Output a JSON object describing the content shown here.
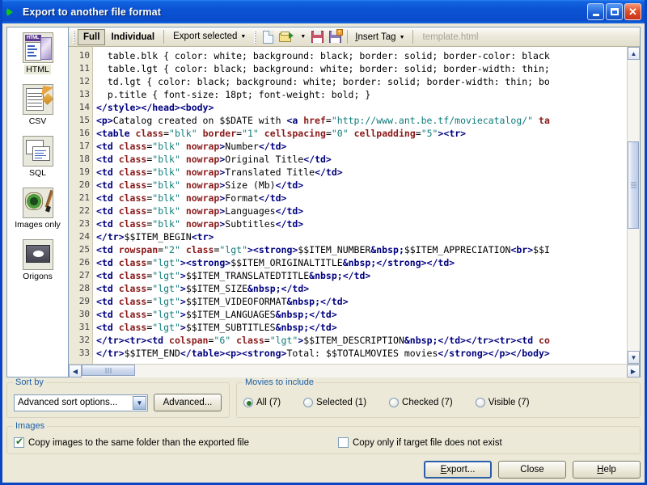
{
  "window": {
    "title": "Export to another file format",
    "icon": "green-arrow-icon",
    "controls": {
      "minimize": "minimize-button",
      "maximize": "maximize-button",
      "close": "close-button"
    }
  },
  "sidebar": {
    "items": [
      {
        "label": "HTML",
        "icon": "html-icon",
        "selected": true
      },
      {
        "label": "CSV",
        "icon": "csv-icon",
        "selected": false
      },
      {
        "label": "SQL",
        "icon": "sql-icon",
        "selected": false
      },
      {
        "label": "Images only",
        "icon": "images-only-icon",
        "selected": false
      },
      {
        "label": "Origons",
        "icon": "origons-icon",
        "selected": false
      }
    ]
  },
  "toolbar": {
    "full_label": "Full",
    "individual_label": "Individual",
    "export_selected_label": "Export selected",
    "new_icon": "new-document-icon",
    "open_icon": "open-folder-icon",
    "save_icon": "save-icon",
    "save_as_icon": "save-as-icon",
    "insert_tag_label_pre": "I",
    "insert_tag_label_post": "nsert Tag",
    "filename": "template.html"
  },
  "editor": {
    "first_line_number": 10,
    "lines": [
      {
        "n": 10,
        "segments": [
          {
            "t": "  table.blk { color: white; background: black; border: solid; border-color: black",
            "c": "t-txt"
          }
        ]
      },
      {
        "n": 11,
        "segments": [
          {
            "t": "  table.lgt { color: black; background: white; border: solid; border-width: thin;",
            "c": "t-txt"
          }
        ]
      },
      {
        "n": 12,
        "segments": [
          {
            "t": "  td.lgt { color: black; background: white; border: solid; border-width: thin; bo",
            "c": "t-txt"
          }
        ]
      },
      {
        "n": 13,
        "segments": [
          {
            "t": "  p.title { font-size: 18pt; font-weight: bold; }",
            "c": "t-txt"
          }
        ]
      },
      {
        "n": 14,
        "segments": [
          {
            "t": "</style><",
            "c": "t-tag"
          },
          {
            "t": "/head><body>",
            "c": "t-tag"
          }
        ]
      },
      {
        "n": 15,
        "segments": [
          {
            "t": "<p>",
            "c": "t-tag"
          },
          {
            "t": "Catalog created on $$DATE with ",
            "c": "t-txt"
          },
          {
            "t": "<a ",
            "c": "t-tag"
          },
          {
            "t": "href",
            "c": "t-attr"
          },
          {
            "t": "=",
            "c": "t-txt"
          },
          {
            "t": "\"http://www.ant.be.tf/moviecatalog/\"",
            "c": "t-val"
          },
          {
            "t": " ta",
            "c": "t-attr"
          }
        ]
      },
      {
        "n": 16,
        "segments": [
          {
            "t": "<table ",
            "c": "t-tag"
          },
          {
            "t": "class",
            "c": "t-attr"
          },
          {
            "t": "=",
            "c": "t-txt"
          },
          {
            "t": "\"blk\"",
            "c": "t-val"
          },
          {
            "t": " border",
            "c": "t-attr"
          },
          {
            "t": "=",
            "c": "t-txt"
          },
          {
            "t": "\"1\"",
            "c": "t-val"
          },
          {
            "t": " cellspacing",
            "c": "t-attr"
          },
          {
            "t": "=",
            "c": "t-txt"
          },
          {
            "t": "\"0\"",
            "c": "t-val"
          },
          {
            "t": " cellpadding",
            "c": "t-attr"
          },
          {
            "t": "=",
            "c": "t-txt"
          },
          {
            "t": "\"5\"",
            "c": "t-val"
          },
          {
            "t": "><tr>",
            "c": "t-tag"
          }
        ]
      },
      {
        "n": 17,
        "segments": [
          {
            "t": "<td ",
            "c": "t-tag"
          },
          {
            "t": "class",
            "c": "t-attr"
          },
          {
            "t": "=",
            "c": "t-txt"
          },
          {
            "t": "\"blk\"",
            "c": "t-val"
          },
          {
            "t": " nowrap",
            "c": "t-attr"
          },
          {
            "t": ">",
            "c": "t-tag"
          },
          {
            "t": "Number",
            "c": "t-txt"
          },
          {
            "t": "</td>",
            "c": "t-tag"
          }
        ]
      },
      {
        "n": 18,
        "segments": [
          {
            "t": "<td ",
            "c": "t-tag"
          },
          {
            "t": "class",
            "c": "t-attr"
          },
          {
            "t": "=",
            "c": "t-txt"
          },
          {
            "t": "\"blk\"",
            "c": "t-val"
          },
          {
            "t": " nowrap",
            "c": "t-attr"
          },
          {
            "t": ">",
            "c": "t-tag"
          },
          {
            "t": "Original Title",
            "c": "t-txt"
          },
          {
            "t": "</td>",
            "c": "t-tag"
          }
        ]
      },
      {
        "n": 19,
        "segments": [
          {
            "t": "<td ",
            "c": "t-tag"
          },
          {
            "t": "class",
            "c": "t-attr"
          },
          {
            "t": "=",
            "c": "t-txt"
          },
          {
            "t": "\"blk\"",
            "c": "t-val"
          },
          {
            "t": " nowrap",
            "c": "t-attr"
          },
          {
            "t": ">",
            "c": "t-tag"
          },
          {
            "t": "Translated Title",
            "c": "t-txt"
          },
          {
            "t": "</td>",
            "c": "t-tag"
          }
        ]
      },
      {
        "n": 20,
        "segments": [
          {
            "t": "<td ",
            "c": "t-tag"
          },
          {
            "t": "class",
            "c": "t-attr"
          },
          {
            "t": "=",
            "c": "t-txt"
          },
          {
            "t": "\"blk\"",
            "c": "t-val"
          },
          {
            "t": " nowrap",
            "c": "t-attr"
          },
          {
            "t": ">",
            "c": "t-tag"
          },
          {
            "t": "Size (Mb)",
            "c": "t-txt"
          },
          {
            "t": "</td>",
            "c": "t-tag"
          }
        ]
      },
      {
        "n": 21,
        "segments": [
          {
            "t": "<td ",
            "c": "t-tag"
          },
          {
            "t": "class",
            "c": "t-attr"
          },
          {
            "t": "=",
            "c": "t-txt"
          },
          {
            "t": "\"blk\"",
            "c": "t-val"
          },
          {
            "t": " nowrap",
            "c": "t-attr"
          },
          {
            "t": ">",
            "c": "t-tag"
          },
          {
            "t": "Format",
            "c": "t-txt"
          },
          {
            "t": "</td>",
            "c": "t-tag"
          }
        ]
      },
      {
        "n": 22,
        "segments": [
          {
            "t": "<td ",
            "c": "t-tag"
          },
          {
            "t": "class",
            "c": "t-attr"
          },
          {
            "t": "=",
            "c": "t-txt"
          },
          {
            "t": "\"blk\"",
            "c": "t-val"
          },
          {
            "t": " nowrap",
            "c": "t-attr"
          },
          {
            "t": ">",
            "c": "t-tag"
          },
          {
            "t": "Languages",
            "c": "t-txt"
          },
          {
            "t": "</td>",
            "c": "t-tag"
          }
        ]
      },
      {
        "n": 23,
        "segments": [
          {
            "t": "<td ",
            "c": "t-tag"
          },
          {
            "t": "class",
            "c": "t-attr"
          },
          {
            "t": "=",
            "c": "t-txt"
          },
          {
            "t": "\"blk\"",
            "c": "t-val"
          },
          {
            "t": " nowrap",
            "c": "t-attr"
          },
          {
            "t": ">",
            "c": "t-tag"
          },
          {
            "t": "Subtitles",
            "c": "t-txt"
          },
          {
            "t": "</td>",
            "c": "t-tag"
          }
        ]
      },
      {
        "n": 24,
        "segments": [
          {
            "t": "</tr>",
            "c": "t-tag"
          },
          {
            "t": "$$ITEM_BEGIN",
            "c": "t-txt"
          },
          {
            "t": "<tr>",
            "c": "t-tag"
          }
        ]
      },
      {
        "n": 25,
        "segments": [
          {
            "t": "<td ",
            "c": "t-tag"
          },
          {
            "t": "rowspan",
            "c": "t-attr"
          },
          {
            "t": "=",
            "c": "t-txt"
          },
          {
            "t": "\"2\"",
            "c": "t-val"
          },
          {
            "t": " class",
            "c": "t-attr"
          },
          {
            "t": "=",
            "c": "t-txt"
          },
          {
            "t": "\"lgt\"",
            "c": "t-val"
          },
          {
            "t": "><strong>",
            "c": "t-tag"
          },
          {
            "t": "$$ITEM_NUMBER",
            "c": "t-txt"
          },
          {
            "t": "&nbsp;",
            "c": "t-ent"
          },
          {
            "t": "$$ITEM_APPRECIATION",
            "c": "t-txt"
          },
          {
            "t": "<br>",
            "c": "t-tag"
          },
          {
            "t": "$$I",
            "c": "t-txt"
          }
        ]
      },
      {
        "n": 26,
        "segments": [
          {
            "t": "<td ",
            "c": "t-tag"
          },
          {
            "t": "class",
            "c": "t-attr"
          },
          {
            "t": "=",
            "c": "t-txt"
          },
          {
            "t": "\"lgt\"",
            "c": "t-val"
          },
          {
            "t": "><strong>",
            "c": "t-tag"
          },
          {
            "t": "$$ITEM_ORIGINALTITLE",
            "c": "t-txt"
          },
          {
            "t": "&nbsp;",
            "c": "t-ent"
          },
          {
            "t": "</strong>",
            "c": "t-tag"
          },
          {
            "t": "</td>",
            "c": "t-tag"
          }
        ]
      },
      {
        "n": 27,
        "segments": [
          {
            "t": "<td ",
            "c": "t-tag"
          },
          {
            "t": "class",
            "c": "t-attr"
          },
          {
            "t": "=",
            "c": "t-txt"
          },
          {
            "t": "\"lgt\"",
            "c": "t-val"
          },
          {
            "t": ">",
            "c": "t-tag"
          },
          {
            "t": "$$ITEM_TRANSLATEDTITLE",
            "c": "t-txt"
          },
          {
            "t": "&nbsp;",
            "c": "t-ent"
          },
          {
            "t": "</td>",
            "c": "t-tag"
          }
        ]
      },
      {
        "n": 28,
        "segments": [
          {
            "t": "<td ",
            "c": "t-tag"
          },
          {
            "t": "class",
            "c": "t-attr"
          },
          {
            "t": "=",
            "c": "t-txt"
          },
          {
            "t": "\"lgt\"",
            "c": "t-val"
          },
          {
            "t": ">",
            "c": "t-tag"
          },
          {
            "t": "$$ITEM_SIZE",
            "c": "t-txt"
          },
          {
            "t": "&nbsp;",
            "c": "t-ent"
          },
          {
            "t": "</td>",
            "c": "t-tag"
          }
        ]
      },
      {
        "n": 29,
        "segments": [
          {
            "t": "<td ",
            "c": "t-tag"
          },
          {
            "t": "class",
            "c": "t-attr"
          },
          {
            "t": "=",
            "c": "t-txt"
          },
          {
            "t": "\"lgt\"",
            "c": "t-val"
          },
          {
            "t": ">",
            "c": "t-tag"
          },
          {
            "t": "$$ITEM_VIDEOFORMAT",
            "c": "t-txt"
          },
          {
            "t": "&nbsp;",
            "c": "t-ent"
          },
          {
            "t": "</td>",
            "c": "t-tag"
          }
        ]
      },
      {
        "n": 30,
        "segments": [
          {
            "t": "<td ",
            "c": "t-tag"
          },
          {
            "t": "class",
            "c": "t-attr"
          },
          {
            "t": "=",
            "c": "t-txt"
          },
          {
            "t": "\"lgt\"",
            "c": "t-val"
          },
          {
            "t": ">",
            "c": "t-tag"
          },
          {
            "t": "$$ITEM_LANGUAGES",
            "c": "t-txt"
          },
          {
            "t": "&nbsp;",
            "c": "t-ent"
          },
          {
            "t": "</td>",
            "c": "t-tag"
          }
        ]
      },
      {
        "n": 31,
        "segments": [
          {
            "t": "<td ",
            "c": "t-tag"
          },
          {
            "t": "class",
            "c": "t-attr"
          },
          {
            "t": "=",
            "c": "t-txt"
          },
          {
            "t": "\"lgt\"",
            "c": "t-val"
          },
          {
            "t": ">",
            "c": "t-tag"
          },
          {
            "t": "$$ITEM_SUBTITLES",
            "c": "t-txt"
          },
          {
            "t": "&nbsp;",
            "c": "t-ent"
          },
          {
            "t": "</td>",
            "c": "t-tag"
          }
        ]
      },
      {
        "n": 32,
        "segments": [
          {
            "t": "</tr><tr><td ",
            "c": "t-tag"
          },
          {
            "t": "colspan",
            "c": "t-attr"
          },
          {
            "t": "=",
            "c": "t-txt"
          },
          {
            "t": "\"6\"",
            "c": "t-val"
          },
          {
            "t": " class",
            "c": "t-attr"
          },
          {
            "t": "=",
            "c": "t-txt"
          },
          {
            "t": "\"lgt\"",
            "c": "t-val"
          },
          {
            "t": ">",
            "c": "t-tag"
          },
          {
            "t": "$$ITEM_DESCRIPTION",
            "c": "t-txt"
          },
          {
            "t": "&nbsp;",
            "c": "t-ent"
          },
          {
            "t": "</td></tr><tr><td ",
            "c": "t-tag"
          },
          {
            "t": "co",
            "c": "t-attr"
          }
        ]
      },
      {
        "n": 33,
        "segments": [
          {
            "t": "</tr>",
            "c": "t-tag"
          },
          {
            "t": "$$ITEM_END",
            "c": "t-txt"
          },
          {
            "t": "</table><p><strong>",
            "c": "t-tag"
          },
          {
            "t": "Total: $$TOTALMOVIES movies",
            "c": "t-txt"
          },
          {
            "t": "</strong></p></body>",
            "c": "t-tag"
          }
        ]
      }
    ]
  },
  "sort_group": {
    "title": "Sort by",
    "combo_value": "Advanced sort options...",
    "advanced_button": "Advanced..."
  },
  "movies_group": {
    "title": "Movies to include",
    "options": [
      {
        "label": "All (7)",
        "selected": true
      },
      {
        "label": "Selected (1)",
        "selected": false
      },
      {
        "label": "Checked (7)",
        "selected": false
      },
      {
        "label": "Visible (7)",
        "selected": false
      }
    ]
  },
  "images_group": {
    "title": "Images",
    "checkboxes": [
      {
        "label": "Copy images to the same folder than the exported file",
        "checked": true
      },
      {
        "label": "Copy only if target file does not exist",
        "checked": false
      }
    ]
  },
  "footer": {
    "export_pre": "E",
    "export_post": "xport...",
    "close_label": "Close",
    "help_pre": "H",
    "help_post": "elp"
  },
  "colors": {
    "titlebar_blue": "#0a4ccb",
    "client_bg": "#ece9d8",
    "group_title": "#1c5fa8",
    "tag": "#000080",
    "attr": "#8b1a1a",
    "value": "#0f7b7b"
  }
}
